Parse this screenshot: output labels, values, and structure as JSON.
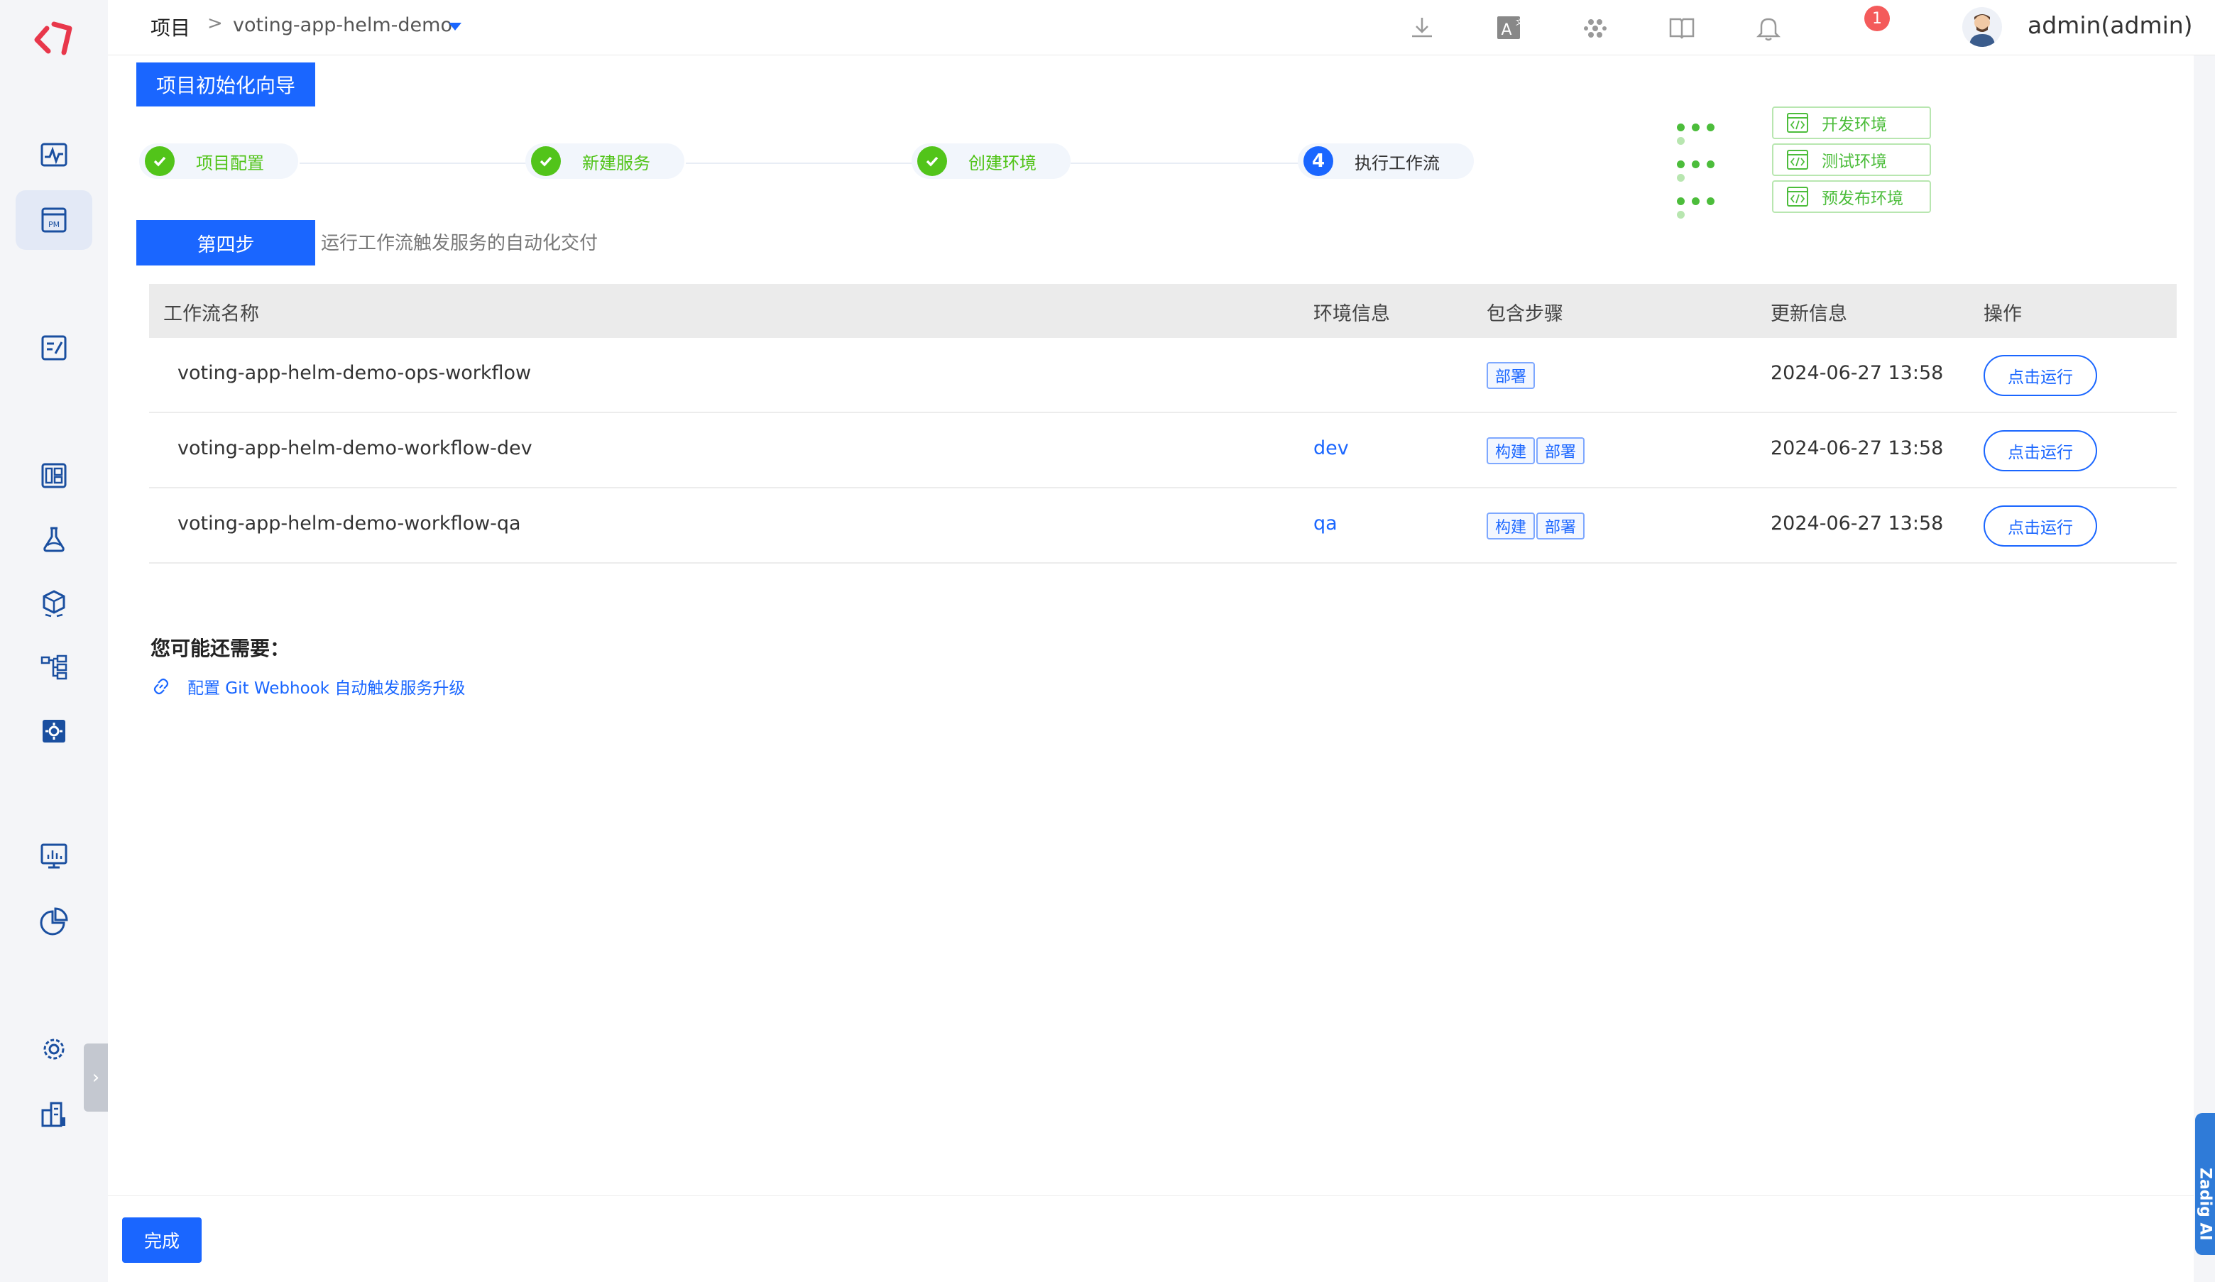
{
  "breadcrumb": {
    "root": "项目",
    "sep": ">",
    "project": "voting-app-helm-demo"
  },
  "header": {
    "notification_count": "1",
    "user": "admin(admin)"
  },
  "wizard": {
    "title": "项目初始化向导",
    "steps": [
      {
        "label": "项目配置",
        "status": "done"
      },
      {
        "label": "新建服务",
        "status": "done"
      },
      {
        "label": "创建环境",
        "status": "done"
      },
      {
        "label": "执行工作流",
        "status": "current",
        "number": "4"
      }
    ],
    "environments": [
      "开发环境",
      "测试环境",
      "预发布环境"
    ],
    "current_step_tag": "第四步",
    "current_step_desc": "运行工作流触发服务的自动化交付"
  },
  "table": {
    "headers": [
      "工作流名称",
      "环境信息",
      "包含步骤",
      "更新信息",
      "操作"
    ],
    "rows": [
      {
        "name": "voting-app-helm-demo-ops-workflow",
        "env": "",
        "tags": [
          "部署"
        ],
        "updated": "2024-06-27 13:58",
        "action": "点击运行"
      },
      {
        "name": "voting-app-helm-demo-workflow-dev",
        "env": "dev",
        "tags": [
          "构建",
          "部署"
        ],
        "updated": "2024-06-27 13:58",
        "action": "点击运行"
      },
      {
        "name": "voting-app-helm-demo-workflow-qa",
        "env": "qa",
        "tags": [
          "构建",
          "部署"
        ],
        "updated": "2024-06-27 13:58",
        "action": "点击运行"
      }
    ]
  },
  "more": {
    "title": "您可能还需要：",
    "link": "配置 Git Webhook 自动触发服务升级"
  },
  "footer": {
    "done_label": "完成"
  },
  "ai_tab": "Zadig AI",
  "colors": {
    "primary": "#1a66ff",
    "success": "#52c41a",
    "env_green": "#4cbd3b",
    "badge_red": "#f45b5b",
    "logo": "#e8374b"
  }
}
